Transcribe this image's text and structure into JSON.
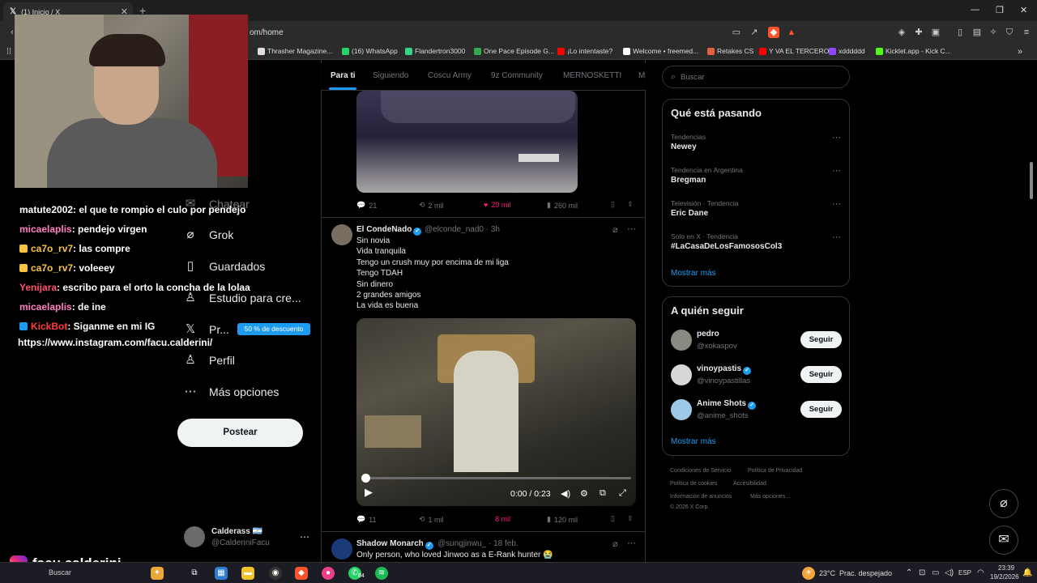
{
  "browser": {
    "tab_title": "(1) Inicio / X",
    "url": "om/home",
    "bookmarks": [
      {
        "label": "Thrasher Magazine...",
        "color": "#e0e0e0"
      },
      {
        "label": "(16) WhatsApp",
        "color": "#25d366"
      },
      {
        "label": "Flandertron3000",
        "color": "#3ad38b"
      },
      {
        "label": "One Pace Episode G...",
        "color": "#34a853"
      },
      {
        "label": "¡Lo intentaste?",
        "color": "#ff0000"
      },
      {
        "label": "Welcome • freemed...",
        "color": "#ffffff"
      },
      {
        "label": "Retakes CS",
        "color": "#e06040"
      },
      {
        "label": "Y VA EL TERCERO",
        "color": "#ff0000"
      },
      {
        "label": "xdddddd",
        "color": "#9146ff"
      },
      {
        "label": "Kicklet.app - Kick C...",
        "color": "#53fc18"
      }
    ]
  },
  "chat": [
    {
      "user": "matute2002",
      "color": "#ffffff",
      "message": ": el que te rompio el culo por pendejo",
      "badge": false
    },
    {
      "user": "micaelaplis",
      "color": "#ff7fbf",
      "message": ": pendejo virgen",
      "badge": false
    },
    {
      "user": "ca7o_rv7",
      "color": "#f6c343",
      "message": ": las compre",
      "badge": true
    },
    {
      "user": "ca7o_rv7",
      "color": "#f6c343",
      "message": ": voleeey",
      "badge": true
    },
    {
      "user": "Yenijara",
      "color": "#ff4f6a",
      "message": ": escribo para el orto la concha de la lolaa",
      "badge": false
    },
    {
      "user": "micaelaplis",
      "color": "#ff7fbf",
      "message": ": de ine",
      "badge": false
    },
    {
      "user": "KickBot",
      "color": "#ff3b3b",
      "message": ": Siganme en mi IG",
      "badge": true
    },
    {
      "user": "",
      "color": "#ffffff",
      "message": "https://www.instagram.com/facu.calderini/",
      "badge": false
    }
  ],
  "streamer": {
    "handle": "facu.calderini"
  },
  "nav": {
    "items": [
      {
        "label": "ciones",
        "icon": "list-icon"
      },
      {
        "label": "Chatear",
        "icon": "mail-icon"
      },
      {
        "label": "Grok",
        "icon": "grok-icon"
      },
      {
        "label": "Guardados",
        "icon": "bookmark-icon"
      },
      {
        "label": "Estudio para cre...",
        "icon": "studio-icon"
      },
      {
        "label": "Pr...",
        "icon": "x-logo-icon"
      },
      {
        "label": "Perfil",
        "icon": "person-icon"
      },
      {
        "label": "Más opciones",
        "icon": "more-circle-icon"
      }
    ],
    "promo": "50 % de descuento",
    "post_label": "Postear",
    "profile_name": "Calderass",
    "profile_handle": "@CalderiniFacu",
    "profile_flag": "🇦🇷"
  },
  "feed": {
    "tabs": [
      "Para ti",
      "Siguiendo",
      "Coscu Army",
      "9z Community",
      "MERNOSKETTI",
      "M"
    ],
    "tweet1_actions": {
      "replies": "21",
      "reposts": "2 mil",
      "likes": "29 mil",
      "views": "260 mil"
    },
    "tweet2": {
      "name": "El CondeNado",
      "handle": "@elconde_nad0 · 3h",
      "lines": [
        "Sin novia",
        "Vida tranquila",
        "Tengo un crush muy por encima de mi liga",
        "Tengo TDAH",
        "Sin dinero",
        "2 grandes amigos",
        "La vida es buena"
      ],
      "video_time": "0:00 / 0:23",
      "actions": {
        "replies": "11",
        "reposts": "1 mil",
        "likes": "8 mil",
        "views": "120 mil"
      }
    },
    "tweet3": {
      "name": "Shadow Monarch",
      "handle": "@sungjinwu_ · 18 feb.",
      "text": "Only person, who loved Jinwoo as a E-Rank hunter 😭"
    }
  },
  "right": {
    "search_placeholder": "Buscar",
    "trends_title": "Qué está pasando",
    "trends": [
      {
        "category": "Tendencias",
        "name": "Newey"
      },
      {
        "category": "Tendencia en Argentina",
        "name": "Bregman"
      },
      {
        "category": "Televisión · Tendencia",
        "name": "Eric Dane"
      },
      {
        "category": "Solo en X · Tendencia",
        "name": "#LaCasaDeLosFamososCol3"
      }
    ],
    "show_more": "Mostrar más",
    "who_title": "A quién seguir",
    "follow": [
      {
        "name": "pedro",
        "handle": "@xokaspov",
        "verified": false,
        "color": "#8a8a80"
      },
      {
        "name": "vinoypastis",
        "handle": "@vinoypastillas",
        "verified": true,
        "color": "#d8d8d8"
      },
      {
        "name": "Anime Shots",
        "handle": "@anime_shots",
        "verified": true,
        "color": "#9ec9e6"
      }
    ],
    "follow_label": "Seguir",
    "footer": [
      "Condiciones de Servicio",
      "Política de Privacidad",
      "Política de cookies",
      "Accesibilidad",
      "Información de anuncios",
      "Más opciones ...",
      "© 2026 X Corp."
    ]
  },
  "taskbar": {
    "search": "Buscar",
    "whatsapp_badge": "84",
    "weather": "23°C",
    "weather_desc": "Prac. despejado",
    "lang": "ESP",
    "time": "23:39",
    "date": "19/2/2026"
  }
}
